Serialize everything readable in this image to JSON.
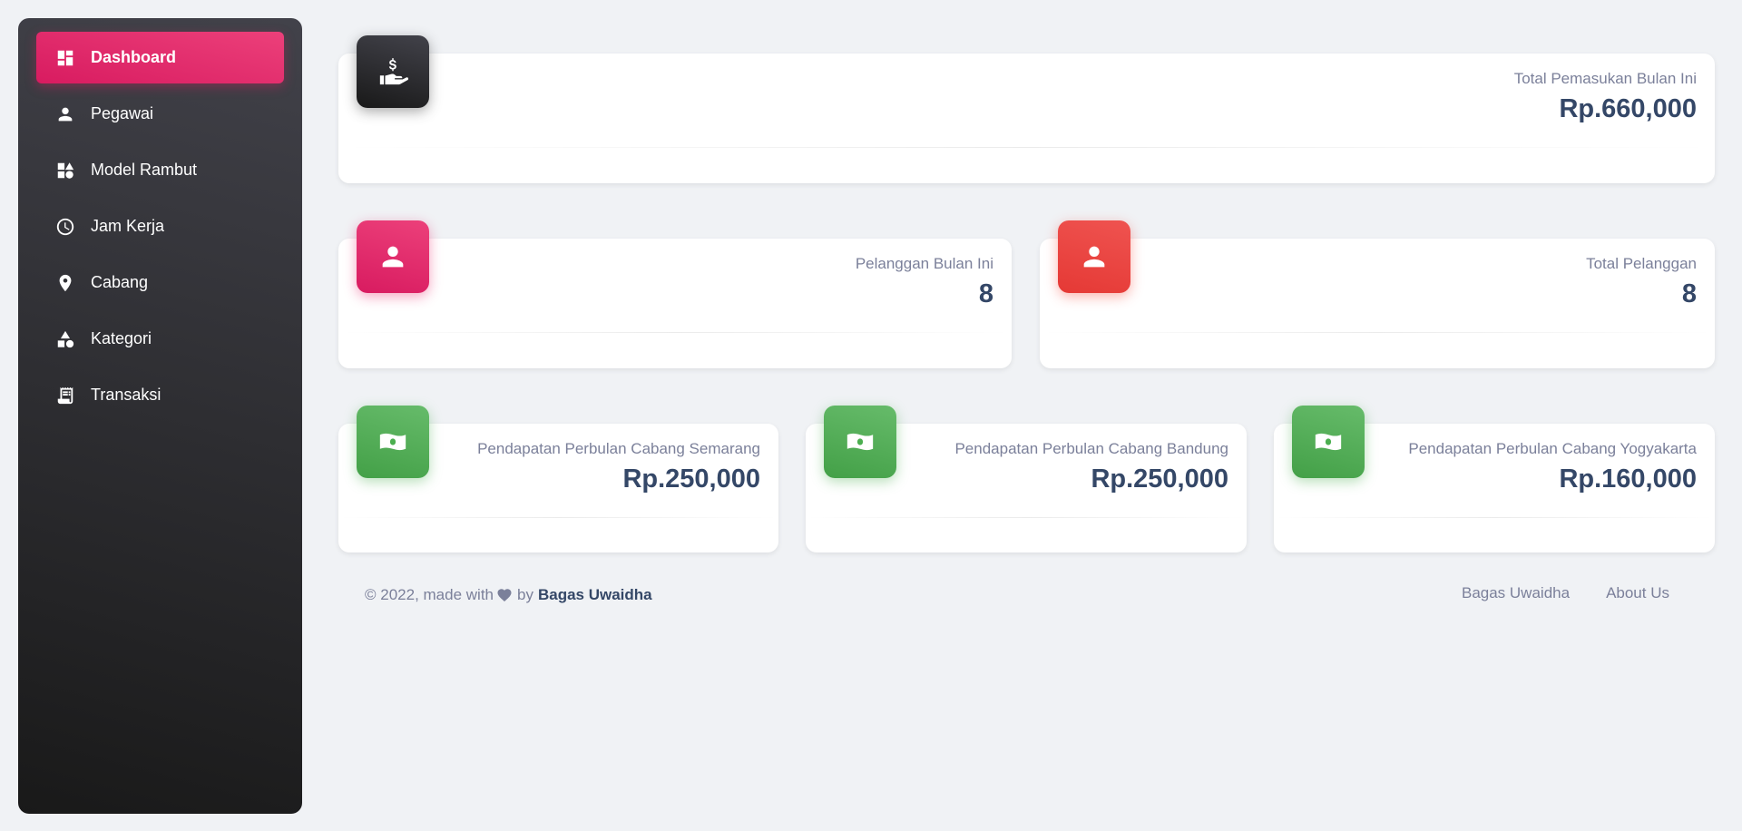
{
  "sidebar": {
    "items": [
      {
        "label": "Dashboard",
        "icon": "dashboard-icon",
        "active": true
      },
      {
        "label": "Pegawai",
        "icon": "person-icon"
      },
      {
        "label": "Model Rambut",
        "icon": "category-icon"
      },
      {
        "label": "Jam Kerja",
        "icon": "clock-icon"
      },
      {
        "label": "Cabang",
        "icon": "location-pin-icon"
      },
      {
        "label": "Kategori",
        "icon": "shapes-icon"
      },
      {
        "label": "Transaksi",
        "icon": "receipt-icon"
      }
    ]
  },
  "cards": {
    "income": {
      "label": "Total Pemasukan Bulan Ini",
      "value": "Rp.660,000",
      "icon": "hand-dollar-icon"
    },
    "customers_month": {
      "label": "Pelanggan Bulan Ini",
      "value": "8",
      "icon": "person-icon"
    },
    "customers_total": {
      "label": "Total Pelanggan",
      "value": "8",
      "icon": "person-icon"
    },
    "branch_semarang": {
      "label": "Pendapatan Perbulan Cabang Semarang",
      "value": "Rp.250,000",
      "icon": "money-icon"
    },
    "branch_bandung": {
      "label": "Pendapatan Perbulan Cabang Bandung",
      "value": "Rp.250,000",
      "icon": "money-icon"
    },
    "branch_yogyakarta": {
      "label": "Pendapatan Perbulan Cabang Yogyakarta",
      "value": "Rp.160,000",
      "icon": "money-icon"
    }
  },
  "footer": {
    "copyright": "© 2022, made with",
    "by": "by",
    "author": "Bagas Uwaidha",
    "links": [
      "Bagas Uwaidha",
      "About Us"
    ]
  },
  "colors": {
    "accent": "#e91e63",
    "dark": "#344767",
    "red": "#f44335",
    "green": "#4caf50",
    "background": "#f0f2f5"
  }
}
